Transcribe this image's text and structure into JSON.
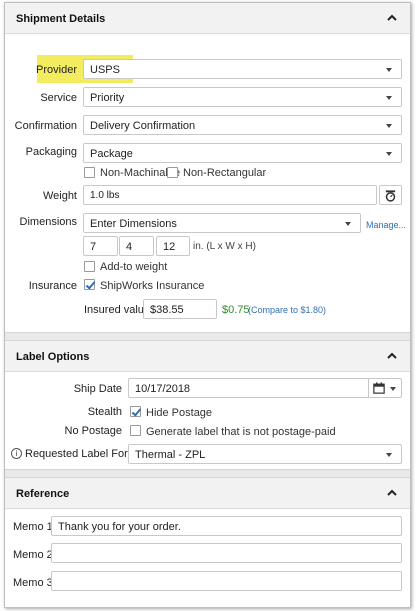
{
  "shipment": {
    "title": "Shipment Details",
    "provider": {
      "label": "Provider",
      "value": "USPS"
    },
    "service": {
      "label": "Service",
      "value": "Priority"
    },
    "confirmation": {
      "label": "Confirmation",
      "value": "Delivery Confirmation"
    },
    "packaging": {
      "label": "Packaging",
      "value": "Package"
    },
    "non_machinable": {
      "label": "Non-Machinable",
      "checked": false
    },
    "non_rectangular": {
      "label": "Non-Rectangular",
      "checked": false
    },
    "weight": {
      "label": "Weight",
      "value": "1.0 lbs"
    },
    "dimensions": {
      "label": "Dimensions",
      "value": "Enter Dimensions",
      "manage_link": "Manage...",
      "length": "7",
      "width": "4",
      "height": "12",
      "unit_hint": "in. (L x W x H)",
      "add_to_weight": {
        "label": "Add-to weight",
        "checked": false
      }
    },
    "insurance": {
      "label": "Insurance",
      "option": {
        "label": "ShipWorks Insurance",
        "checked": true
      },
      "insured_value_label": "Insured value",
      "insured_value": "$38.55",
      "cost": "$0.75",
      "compare": "(Compare to $1.80)"
    }
  },
  "label_options": {
    "title": "Label Options",
    "ship_date": {
      "label": "Ship Date",
      "value": "10/17/2018"
    },
    "stealth": {
      "label": "Stealth",
      "option_label": "Hide Postage",
      "checked": true
    },
    "no_postage": {
      "label": "No Postage",
      "option_label": "Generate label that is not postage-paid",
      "checked": false
    },
    "format": {
      "label": "Requested Label Format",
      "value": "Thermal - ZPL",
      "info_glyph": "i"
    }
  },
  "reference": {
    "title": "Reference",
    "memo1": {
      "label": "Memo 1",
      "value": "Thank you for your order."
    },
    "memo2": {
      "label": "Memo 2",
      "value": ""
    },
    "memo3": {
      "label": "Memo 3",
      "value": ""
    }
  },
  "colors": {
    "highlight": "#f3ec60",
    "link": "#2f6fb3",
    "cost_green": "#2e8b2e"
  },
  "icons": {
    "collapse": "chevron-up-icon",
    "scale": "scale-icon",
    "calendar": "calendar-icon",
    "info": "info-icon"
  }
}
